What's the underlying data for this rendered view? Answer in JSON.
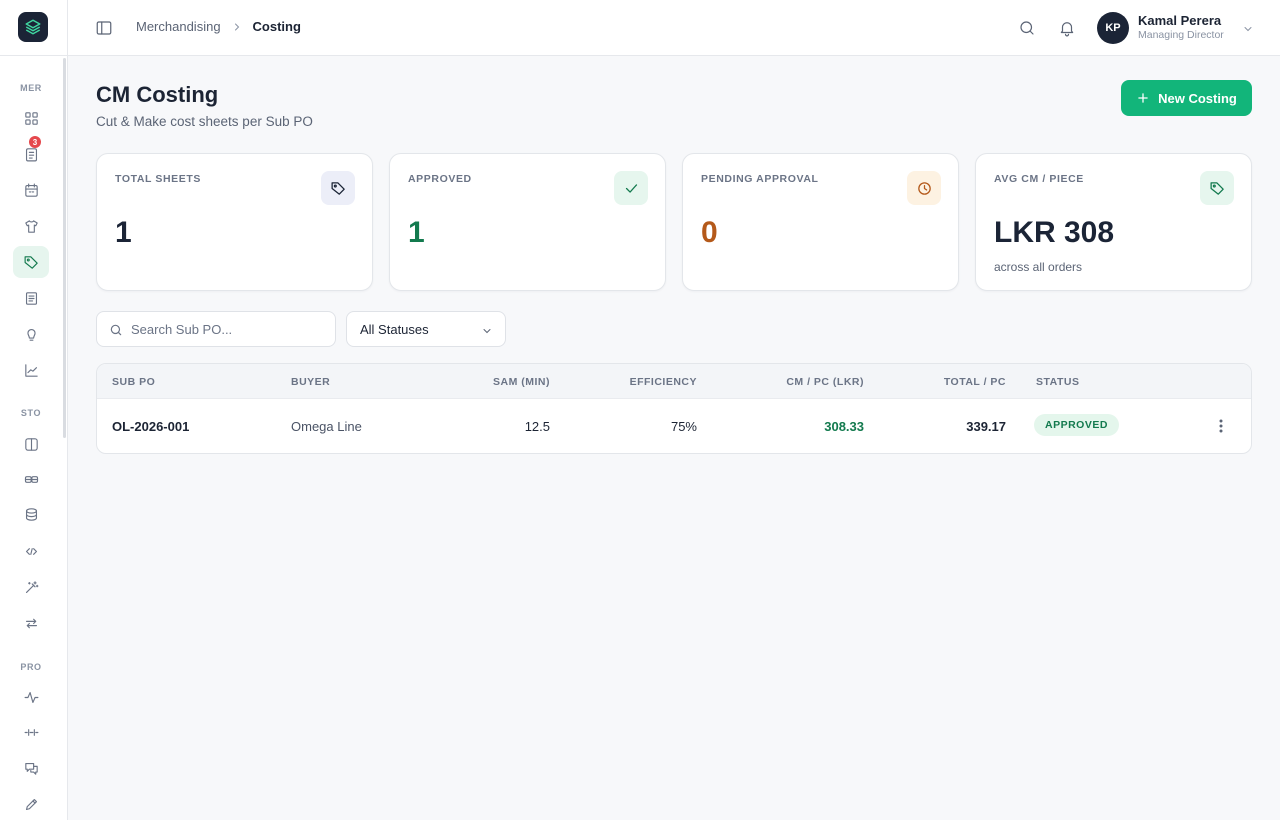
{
  "sidebar": {
    "sections": [
      "MER",
      "STO",
      "PRO"
    ],
    "merchandising_items": [
      "dashboard-icon",
      "orders-icon",
      "calendar-icon",
      "shirt-icon",
      "tag-icon",
      "document-icon",
      "lightbulb-icon",
      "chart-icon"
    ],
    "orders_badge": "3",
    "store_items": [
      "book-icon",
      "rack-icon",
      "database-icon",
      "code-icon",
      "wand-icon",
      "transfer-icon"
    ],
    "production_items": [
      "activity-icon",
      "line-icon",
      "chat-icon",
      "pencil-icon"
    ],
    "active_item": "tag-icon"
  },
  "header": {
    "breadcrumb": [
      "Merchandising",
      "Costing"
    ],
    "user": {
      "initials": "KP",
      "name": "Kamal Perera",
      "role": "Managing Director"
    }
  },
  "page": {
    "title": "CM Costing",
    "subtitle": "Cut & Make cost sheets per Sub PO",
    "new_button": "New Costing"
  },
  "stats": [
    {
      "label": "TOTAL SHEETS",
      "value": "1",
      "icon": "tag-icon",
      "color": "#1b2436"
    },
    {
      "label": "APPROVED",
      "value": "1",
      "icon": "check-icon",
      "color": "#137a4e"
    },
    {
      "label": "PENDING APPROVAL",
      "value": "0",
      "icon": "clock-icon",
      "color": "#b4591a"
    },
    {
      "label": "AVG CM / PIECE",
      "value": "LKR 308",
      "note": "across all orders",
      "icon": "tag-icon",
      "color": "#1b2436"
    }
  ],
  "filters": {
    "search_placeholder": "Search Sub PO...",
    "status_value": "All Statuses"
  },
  "table": {
    "columns": [
      "SUB PO",
      "BUYER",
      "SAM (MIN)",
      "EFFICIENCY",
      "CM / PC (LKR)",
      "TOTAL / PC",
      "STATUS"
    ],
    "rows": [
      {
        "sub_po": "OL-2026-001",
        "buyer": "Omega Line",
        "sam": "12.5",
        "efficiency": "75%",
        "cm_pc": "308.33",
        "total_pc": "339.17",
        "status": "APPROVED"
      }
    ]
  },
  "colors": {
    "accent": "#12b57a",
    "navy": "#1b2436",
    "approved_green": "#137a4e",
    "pending_orange": "#b4591a"
  }
}
